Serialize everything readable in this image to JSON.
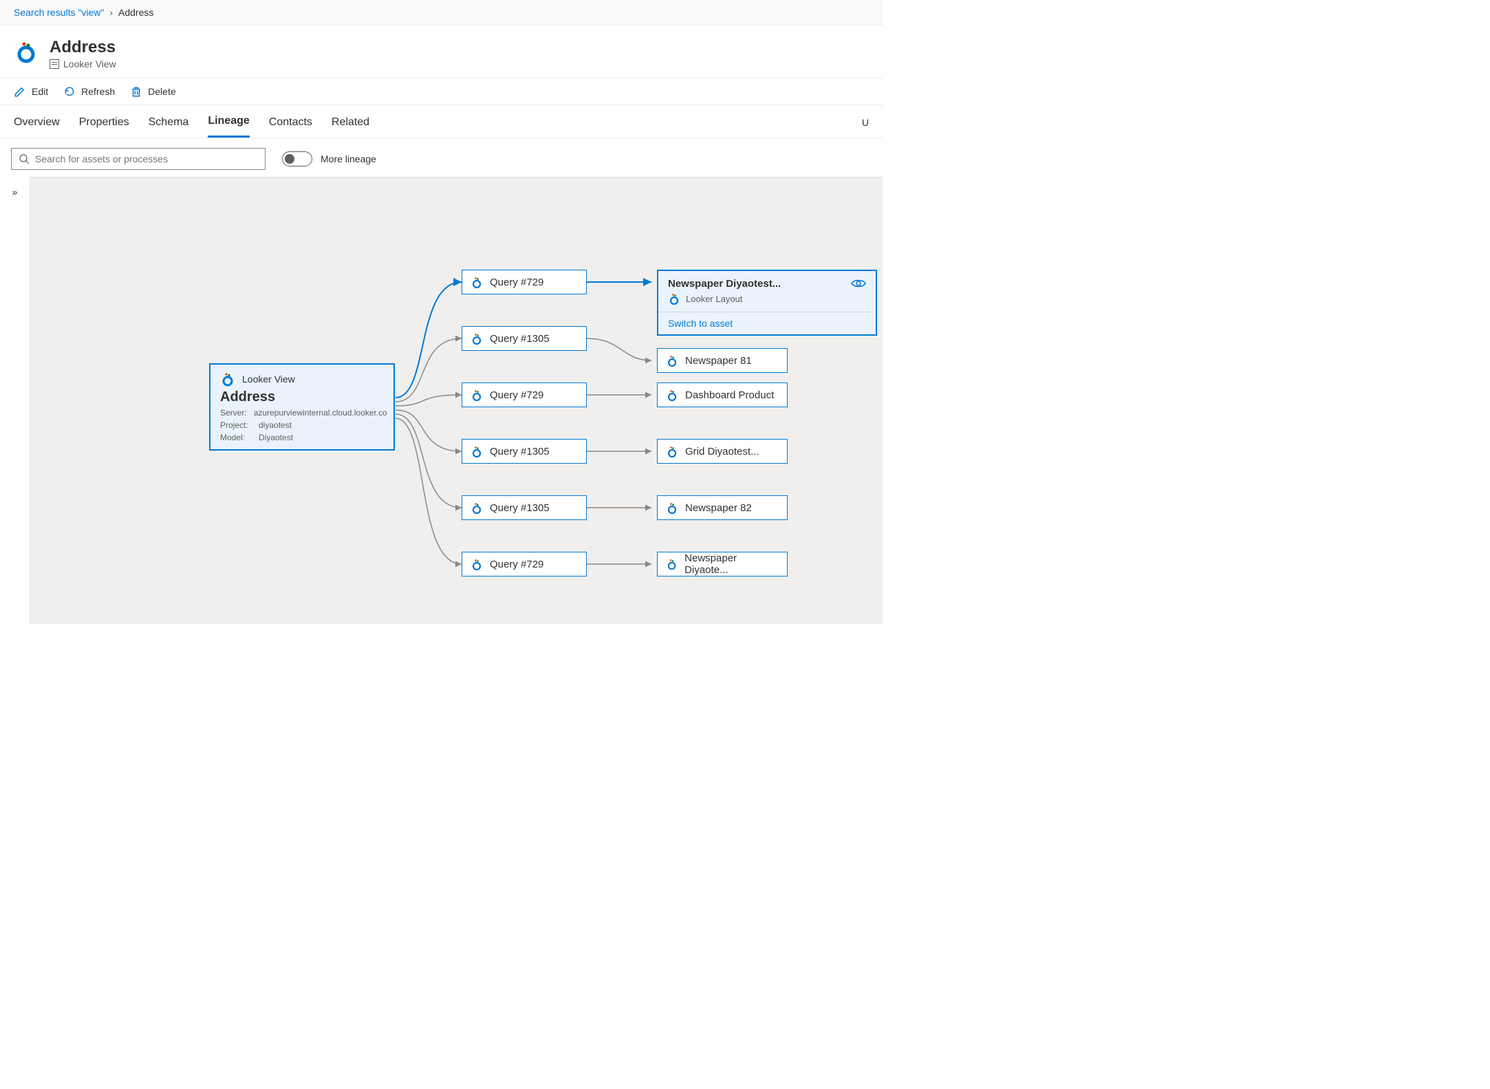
{
  "breadcrumb": {
    "back": "Search results \"view\"",
    "current": "Address"
  },
  "header": {
    "title": "Address",
    "subtype": "Looker View"
  },
  "toolbar": {
    "edit": "Edit",
    "refresh": "Refresh",
    "delete": "Delete"
  },
  "tabs": {
    "overview": "Overview",
    "properties": "Properties",
    "schema": "Schema",
    "lineage": "Lineage",
    "contacts": "Contacts",
    "related": "Related",
    "right": "U"
  },
  "controls": {
    "search_placeholder": "Search for assets or processes",
    "more_lineage": "More lineage"
  },
  "source": {
    "type": "Looker View",
    "title": "Address",
    "server_label": "Server:",
    "server": "azurepurviewinternal.cloud.looker.co",
    "project_label": "Project:",
    "project": "diyaotest",
    "model_label": "Model:",
    "model": "Diyaotest"
  },
  "mid_nodes": [
    "Query #729",
    "Query #1305",
    "Query #729",
    "Query #1305",
    "Query #1305",
    "Query #729"
  ],
  "right_nodes": [
    "Newspaper 81",
    "Dashboard Product",
    "Grid Diyaotest...",
    "Newspaper 82",
    "Newspaper Diyaote..."
  ],
  "selected_target": {
    "title": "Newspaper Diyaotest...",
    "subtype": "Looker Layout",
    "switch": "Switch to asset"
  }
}
